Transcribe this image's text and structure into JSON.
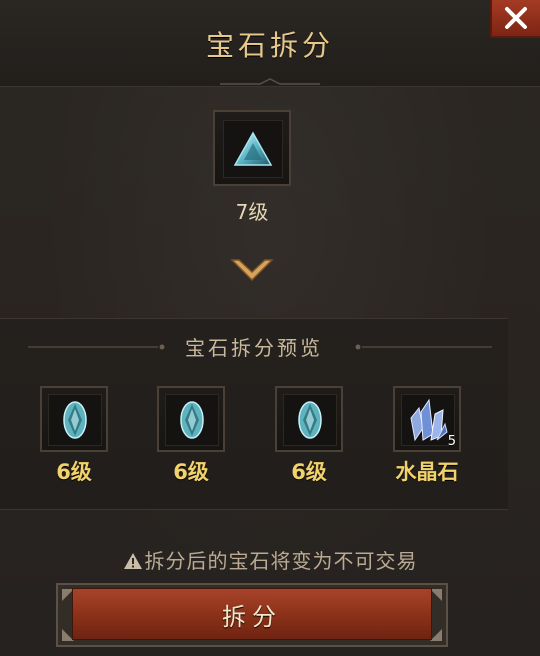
{
  "dialog": {
    "title": "宝石拆分",
    "close_icon": "close-icon"
  },
  "source_gem": {
    "icon": "triangle-gem-icon",
    "level": "7级"
  },
  "arrow_icon": "chevron-down-icon",
  "preview": {
    "title": "宝石拆分预览",
    "items": [
      {
        "icon": "oval-gem-icon",
        "label": "6级",
        "quantity": ""
      },
      {
        "icon": "oval-gem-icon",
        "label": "6级",
        "quantity": ""
      },
      {
        "icon": "oval-gem-icon",
        "label": "6级",
        "quantity": ""
      },
      {
        "icon": "crystal-icon",
        "label": "水晶石",
        "quantity": "5"
      }
    ]
  },
  "warning": {
    "icon": "warning-icon",
    "text": "拆分后的宝石将变为不可交易"
  },
  "action": {
    "label": "拆分"
  },
  "colors": {
    "accent_gold": "#e6c88d",
    "label_yellow": "#f2d26a",
    "button_red": "#8a3018",
    "background": "#2a2622"
  }
}
